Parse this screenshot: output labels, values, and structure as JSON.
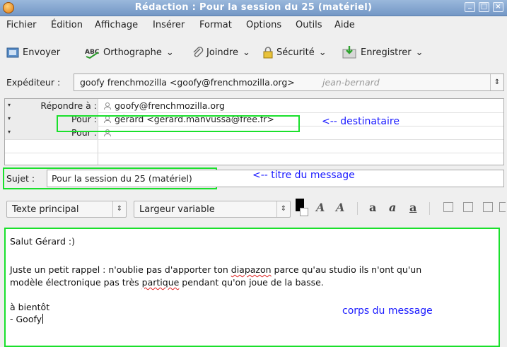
{
  "window": {
    "title": "Rédaction : Pour la session du 25 (matériel)"
  },
  "menu": [
    "Fichier",
    "Édition",
    "Affichage",
    "Insérer",
    "Format",
    "Options",
    "Outils",
    "Aide"
  ],
  "toolbar": {
    "send": "Envoyer",
    "spelling": "Orthographe",
    "attach": "Joindre",
    "security": "Sécurité",
    "save": "Enregistrer"
  },
  "sender": {
    "label": "Expéditeur :",
    "value": "goofy frenchmozilla <goofy@frenchmozilla.org>",
    "identity_hint": "jean-bernard"
  },
  "recipients": [
    {
      "type": "Répondre à :",
      "address": "goofy@frenchmozilla.org"
    },
    {
      "type": "Pour :",
      "address": "gérard <gerard.manvussa@free.fr>"
    },
    {
      "type": "Pour :",
      "address": ""
    }
  ],
  "subject": {
    "label": "Sujet :",
    "value": "Pour la session du 25 (matériel)"
  },
  "format": {
    "paragraph_style": "Texte principal",
    "font": "Largeur variable"
  },
  "body": {
    "greeting": "Salut Gérard :)",
    "line1_before": "Juste un petit rappel : n'oublie pas d'apporter ton ",
    "line1_misspelled": "diapazon",
    "line1_after": " parce qu'au studio ils n'ont qu'un",
    "line2_before": "modèle électronique pas très ",
    "line2_misspelled": "partique",
    "line2_after": " pendant qu'on joue de la basse.",
    "closing": "à bientôt",
    "signature": "- Goofy"
  },
  "annotations": {
    "recipient": "<-- destinataire",
    "subject": "<-- titre du message",
    "body": "corps du message"
  },
  "colors": {
    "highlight": "#1ae02c",
    "annotation": "#1a1aff",
    "titlebar": "#7f9fcb"
  }
}
